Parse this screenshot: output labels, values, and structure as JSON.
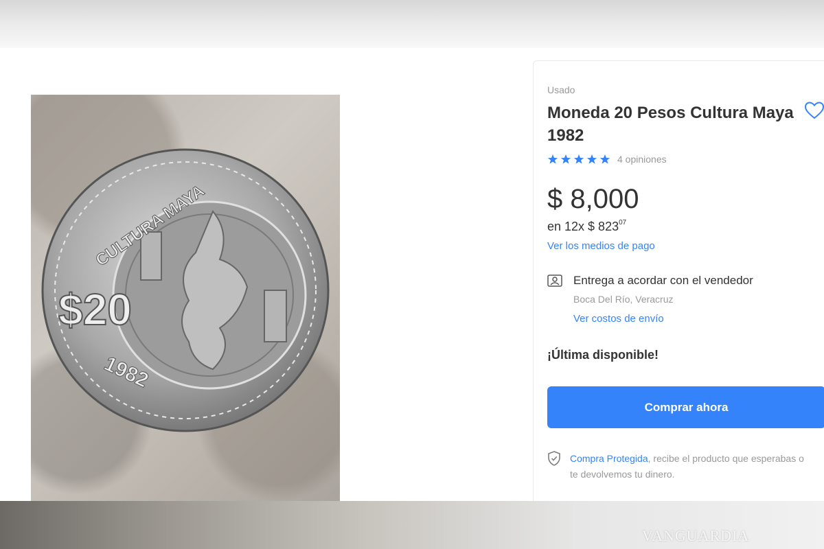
{
  "product": {
    "condition": "Usado",
    "title": "Moneda 20 Pesos Cultura Maya 1982",
    "rating": 5,
    "reviews_label": "4 opiniones",
    "price": "$ 8,000",
    "installments_prefix": "en 12x $ 823",
    "installments_cents": "07",
    "payment_link": "Ver los medios de pago"
  },
  "delivery": {
    "title": "Entrega a acordar con el vendedor",
    "location": "Boca Del Río, Veracruz",
    "shipping_link": "Ver costos de envío"
  },
  "stock_label": "¡Última disponible!",
  "buy_button": "Comprar ahora",
  "protection": {
    "link": "Compra Protegida",
    "text": ", recibe el producto que esperabas o te devolvemos tu dinero."
  },
  "coin": {
    "top_text": "CULTURA MAYA",
    "denomination": "$20",
    "year": "1982"
  },
  "watermark": "VANGUARDIA",
  "colors": {
    "accent": "#3483fa",
    "text_primary": "#333333",
    "text_secondary": "#999999"
  },
  "icons": [
    "heart-icon",
    "star-icon",
    "delivery-icon",
    "shield-icon"
  ]
}
